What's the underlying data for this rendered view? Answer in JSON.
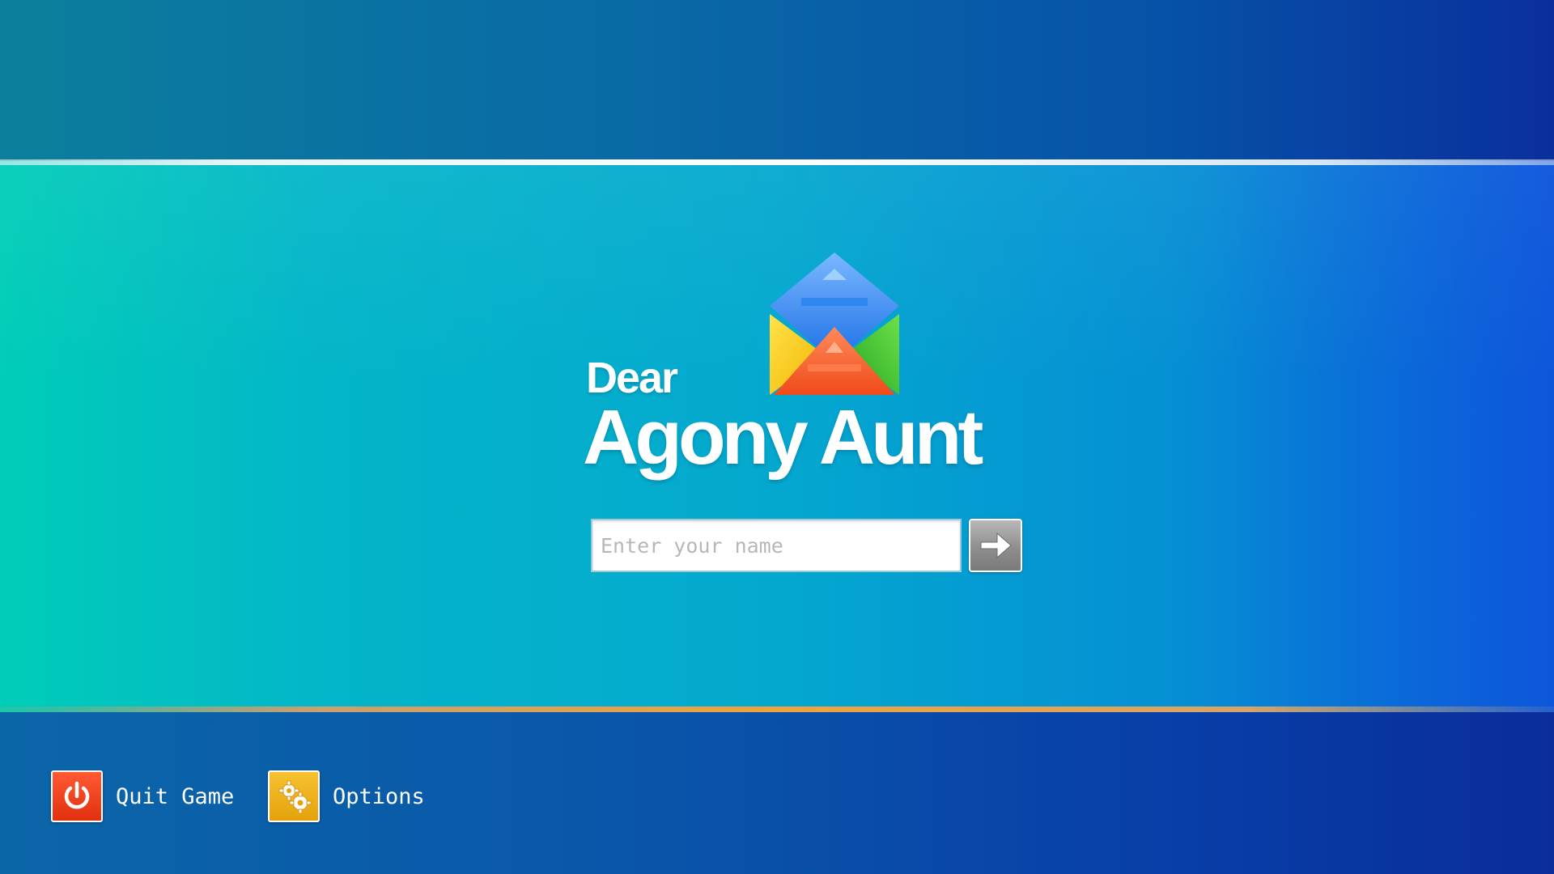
{
  "logo": {
    "dear": "Dear",
    "title": "Agony Aunt"
  },
  "name_entry": {
    "placeholder": "Enter your name",
    "value": ""
  },
  "menu": {
    "quit_label": "Quit Game",
    "options_label": "Options"
  },
  "icons": {
    "logo": "envelope-logo-icon",
    "submit": "arrow-right-icon",
    "quit": "power-icon",
    "options": "gears-icon"
  },
  "colors": {
    "quit_button": "#e8400f",
    "options_button": "#f0b41c",
    "submit_button": "#8e8e8e",
    "accent_line": "#f0a23c"
  }
}
